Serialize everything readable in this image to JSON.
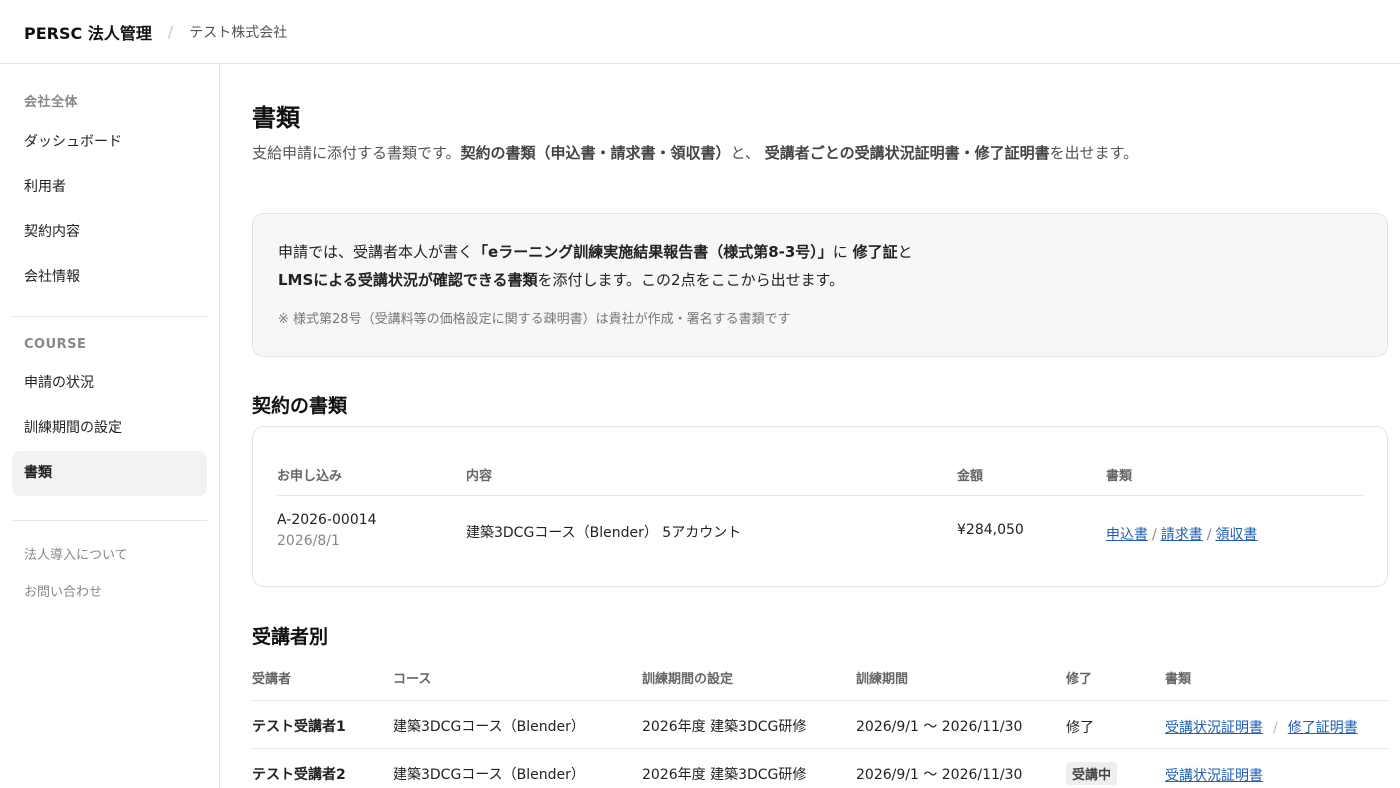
{
  "header": {
    "brand": "PERSC 法人管理",
    "separator": "/",
    "company": "テスト株式会社"
  },
  "sidebar": {
    "section1_heading": "会社全体",
    "section1_items": [
      {
        "label": "ダッシュボード"
      },
      {
        "label": "利用者"
      },
      {
        "label": "契約内容"
      },
      {
        "label": "会社情報"
      }
    ],
    "section2_heading": "COURSE",
    "section2_items": [
      {
        "label": "申請の状況"
      },
      {
        "label": "訓練期間の設定"
      },
      {
        "label": "書類",
        "active": true
      }
    ],
    "footer_links": [
      {
        "label": "法人導入について"
      },
      {
        "label": "お問い合わせ"
      }
    ]
  },
  "page": {
    "title": "書類",
    "desc_1": "支給申請に添付する書類です。",
    "desc_2": "契約の書類（申込書・請求書・領収書）",
    "desc_3": "と、",
    "desc_4": "受講者ごとの受講状況証明書・修了証明書",
    "desc_5": "を出せます。"
  },
  "info": {
    "l1_a": "申請では、受講者本人が書く",
    "l1_b": "「eラーニング訓練実施結果報告書（様式第8-3号）」",
    "l1_c": "に",
    "l1_d": "修了証",
    "l1_e": "と",
    "l2_a": "LMSによる受講状況が確認できる書類",
    "l2_b": "を添付します。この2点をここから出せます。",
    "note": "※ 様式第28号（受講料等の価格設定に関する疎明書）は貴社が作成・署名する書類です"
  },
  "contract": {
    "section_title": "契約の書類",
    "columns": [
      "お申し込み",
      "内容",
      "金額",
      "書類"
    ],
    "row": {
      "id": "A-2026-00014",
      "date": "2026/8/1",
      "content": "建築3DCGコース（Blender） 5アカウント",
      "amount": "¥284,050",
      "links": [
        "申込書",
        "請求書",
        "領収書"
      ],
      "link_sep": "/"
    }
  },
  "students": {
    "section_title": "受講者別",
    "columns": [
      "受講者",
      "コース",
      "訓練期間の設定",
      "訓練期間",
      "修了",
      "書類"
    ],
    "link_sep": "/",
    "rows": [
      {
        "name": "テスト受講者1",
        "course": "建築3DCGコース（Blender）",
        "setting": "2026年度 建築3DCG研修",
        "period": "2026/9/1 〜 2026/11/30",
        "status": "修了",
        "links": [
          "受講状況証明書",
          "修了証明書"
        ]
      },
      {
        "name": "テスト受講者2",
        "course": "建築3DCGコース（Blender）",
        "setting": "2026年度 建築3DCG研修",
        "period": "2026/9/1 〜 2026/11/30",
        "status": "受講中",
        "links": [
          "受講状況証明書"
        ]
      }
    ]
  }
}
